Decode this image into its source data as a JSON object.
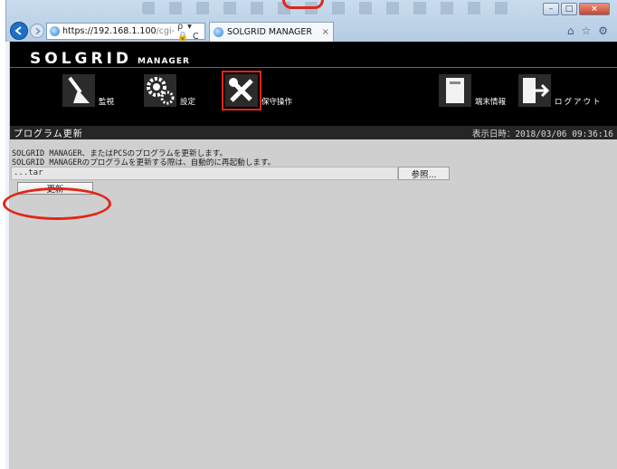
{
  "browser": {
    "url_host": "https://192.168.1.100",
    "url_path": "/cgi-",
    "address_controls": "ρ ▾ 🔒 C",
    "tab_title": "SOLGRID MANAGER",
    "tab_close": "×",
    "window_controls": {
      "minimize": "–",
      "maximize": "□",
      "close": "×"
    },
    "toolbar_icons": [
      "home-icon",
      "star-icon",
      "gear-icon"
    ],
    "toolbar_glyphs": [
      "⌂",
      "☆",
      "⚙"
    ]
  },
  "header": {
    "logo": "SOLGRID",
    "logo_sub": "MANAGER",
    "nav": [
      {
        "id": "monitor",
        "label": "監視",
        "icon": "broom-icon"
      },
      {
        "id": "settings",
        "label": "設定",
        "icon": "gears-icon"
      },
      {
        "id": "maintenance",
        "label": "保守操作",
        "icon": "tools-icon",
        "selected": true
      },
      {
        "id": "terminal",
        "label": "端末情報",
        "icon": "terminal-icon"
      },
      {
        "id": "logout",
        "label": "ログアウト",
        "icon": "logout-icon"
      }
    ]
  },
  "titlebar": {
    "title": "プログラム更新",
    "datetime": "表示日時：2018/03/06 09:36:16"
  },
  "content": {
    "description_1": "SOLGRID MANAGER、またはPCSのプログラムを更新します。",
    "description_2": "SOLGRID MANAGERのプログラムを更新する際は、自動的に再起動します。",
    "file_value": "...tar",
    "browse_label": "参照...",
    "update_label": "更新"
  },
  "colors": {
    "header_bg": "#000000",
    "titlebar_bg": "#262626",
    "content_bg": "#cfcfcf",
    "highlight": "#e0261a"
  }
}
